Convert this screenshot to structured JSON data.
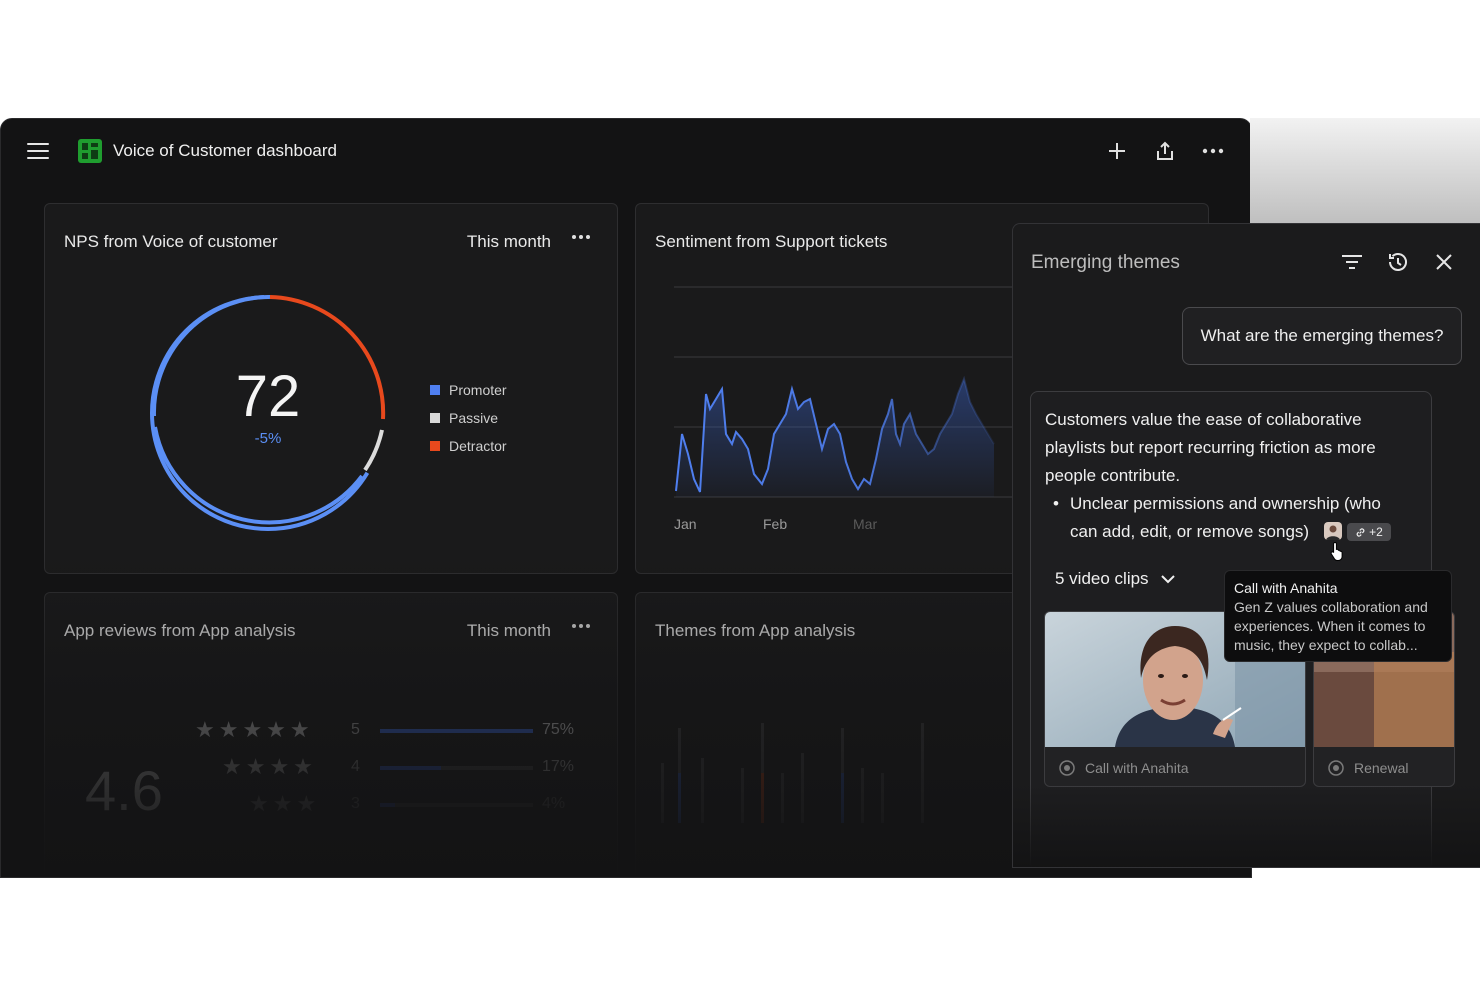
{
  "app": {
    "title": "Voice of Customer dashboard"
  },
  "cards": {
    "nps": {
      "title": "NPS from Voice of customer",
      "period": "This month",
      "score": "72",
      "delta": "-5%",
      "legend": [
        {
          "label": "Promoter",
          "color": "#4f7ff0"
        },
        {
          "label": "Passive",
          "color": "#d9d9d9"
        },
        {
          "label": "Detractor",
          "color": "#e8491d"
        }
      ]
    },
    "sentiment": {
      "title": "Sentiment from Support tickets",
      "months": [
        "Jan",
        "Feb",
        "Mar"
      ]
    },
    "reviews": {
      "title": "App reviews from App analysis",
      "period": "This month",
      "average": "4.6",
      "rows": [
        {
          "stars": "5",
          "percent": "75%",
          "fill": 1.0
        },
        {
          "stars": "4",
          "percent": "17%",
          "fill": 0.4
        },
        {
          "stars": "3",
          "percent": "4%",
          "fill": 0.1
        }
      ]
    },
    "themes": {
      "title": "Themes from App analysis"
    }
  },
  "panel": {
    "title": "Emerging themes",
    "question": "What are the emerging themes?",
    "answer": "Customers value the ease of collaborative playlists but report recurring friction as more people contribute.",
    "bullet": "Unclear permissions and ownership (who can add, edit, or remove songs)",
    "source_count": "+2",
    "clips_label": "5 video clips",
    "clips": [
      {
        "label": "Call with Anahita"
      },
      {
        "label": "Renewal"
      }
    ],
    "tooltip": {
      "title": "Call with Anahita",
      "body": "Gen Z values collaboration and experiences. When it comes to music, they expect to collab..."
    }
  },
  "colors": {
    "accent_blue": "#4f7ff0",
    "detractor": "#e8491d",
    "logo_green": "#1f9d2f"
  }
}
